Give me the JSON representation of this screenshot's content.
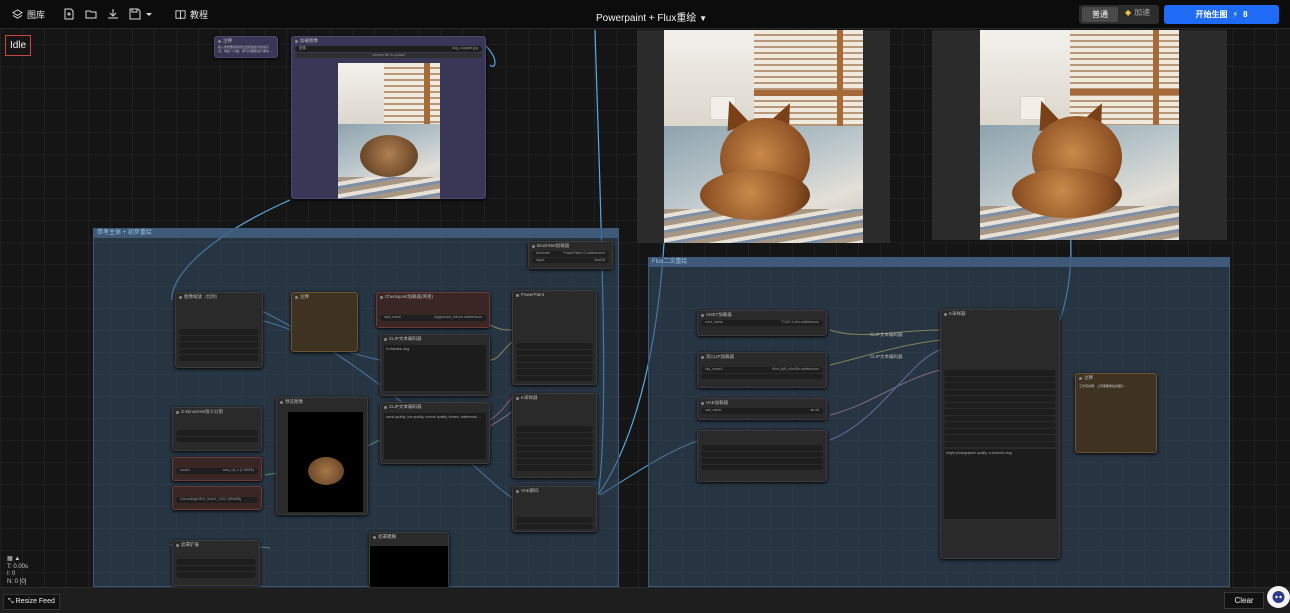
{
  "topbar": {
    "library_label": "图库",
    "tutorial_label": "教程",
    "workflow_title": "Powerpaint + Flux重绘",
    "mode_normal": "普通",
    "mode_boost": "加速",
    "run_label": "开始生图",
    "run_cost": "8"
  },
  "status": {
    "idle_label": "Idle"
  },
  "groups": {
    "left_title": "参考主体 + 初步重绘",
    "right_title": "Flux二次重绘"
  },
  "nodes": {
    "note_top_title": "注释",
    "note_top_text": "输入你想要替换的位置和描述词的提示词，例如一只猫，即可对图像进行重绘 ...",
    "load_image_title": "加载图像",
    "load_image_file": "dog_outpaint.jpg",
    "upload_label": "choose file to upload",
    "brushnet_title": "BrushNet加载器",
    "brushnet_row1": "PowerPaint v2 safetensors",
    "brushnet_row2": "float16",
    "size_title": "图像缩放（比例）",
    "note_left_title": "注释",
    "ckpt_title": "Checkpoint加载器(简易)",
    "ckpt_value": "juggernaut_reborn.safetensors",
    "clip_pos_title": "CLIP文本编码器",
    "clip_pos_text": "A chaoshu dog",
    "clip_neg_title": "CLIP文本编码器",
    "clip_neg_text": "worst quality, low quality, normal quality, lowres, watermark ...",
    "powerpaint_title": "PowerPaint",
    "sampler_title": "K采样器",
    "vae_decode_title": "VAE解码",
    "preview_title": "预览图像",
    "sam_title": "G-DinoSAM语义分割",
    "sam_model": "sam_vit_h (2.56GB)",
    "dino_model": "GroundingDINO_SwinT_OGC (694MB)",
    "mask_title": "遮罩扩展",
    "blur_title": "遮罩模糊",
    "unet_title": "UNET加载器",
    "unet_value": "FLUX.1-dev.safetensors",
    "dual_clip_title": "双CLIP加载器",
    "dual_clip_value": "t5xxl_fp8_e4m3fn.safetensors",
    "vae_loader_title": "VAE加载器",
    "vae_loader_value": "ae.sft",
    "flux_clip_a": "CLIP文本编码器",
    "flux_clip_b": "CLIP文本编码器",
    "ksampler2_title": "K采样器",
    "ksampler2_text": "bright photographic quality, a chaoshu dog",
    "note_right_title": "注释",
    "note_right_text": "工作流说明：上传需要重绘的图片 ...",
    "vae_decode2_title": "VAE解码"
  },
  "bottom": {
    "resize_label": "Resize Feed",
    "clear_label": "Clear",
    "stat_time": "T: 0.00s",
    "stat_i": "I: 0",
    "stat_n": "N: 0 [0]"
  }
}
